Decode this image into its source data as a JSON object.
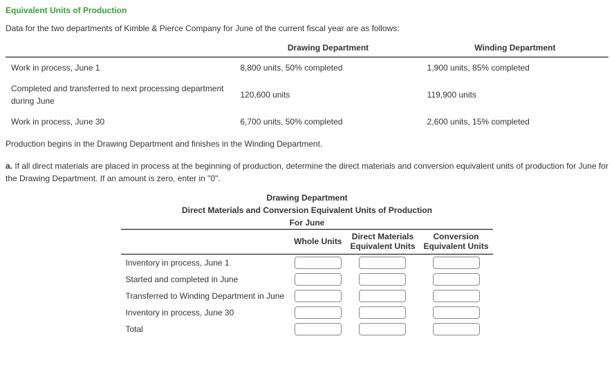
{
  "title": "Equivalent Units of Production",
  "intro": "Data for the two departments of Kimble & Pierce Company for June of the current fiscal year are as follows:",
  "data_table": {
    "col1": "Drawing Department",
    "col2": "Winding Department",
    "rows": [
      {
        "label": "Work in process, June 1",
        "c1": "8,800 units, 50% completed",
        "c2": "1,900 units, 85% completed"
      },
      {
        "label": "Completed and transferred to next processing department during June",
        "c1": "120,600 units",
        "c2": "119,900 units"
      },
      {
        "label": "Work in process, June 30",
        "c1": "6,700 units, 50% completed",
        "c2": "2,600 units, 15% completed"
      }
    ]
  },
  "note": "Production begins in the Drawing Department and finishes in the Winding Department.",
  "question_a": "a.  If all direct materials are placed in process at the beginning of production, determine the direct materials and conversion equivalent units of production for June for the Drawing Department. If an amount is zero, enter in \"0\".",
  "answer_header": {
    "line1": "Drawing Department",
    "line2": "Direct Materials and Conversion Equivalent Units of Production",
    "line3": "For June"
  },
  "answer_table": {
    "col_heads": [
      "Whole Units",
      "Direct Materials Equivalent Units",
      "Conversion Equivalent Units"
    ],
    "rows": [
      "Inventory in process, June 1",
      "Started and completed in June",
      "Transferred to Winding Department in June",
      "Inventory in process, June 30",
      "Total"
    ]
  }
}
